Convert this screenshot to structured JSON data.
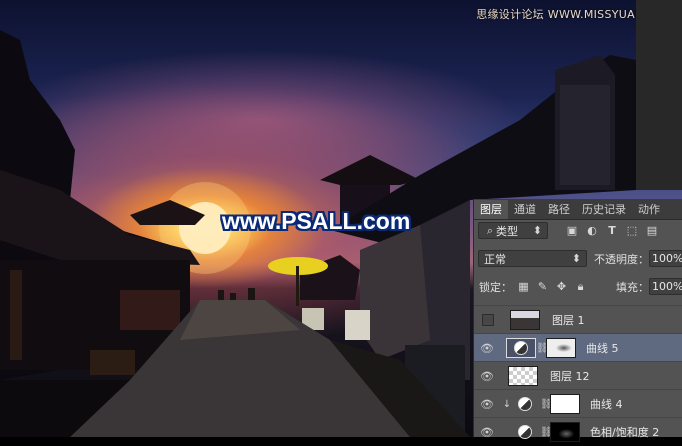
{
  "watermark": {
    "top_right": "思缘设计论坛 WWW.MISSYUAN.COM",
    "center": "www.PSALL.com"
  },
  "layers_panel": {
    "tabs": [
      {
        "label": "图层",
        "active": true
      },
      {
        "label": "通道",
        "active": false
      },
      {
        "label": "路径",
        "active": false
      },
      {
        "label": "历史记录",
        "active": false
      },
      {
        "label": "动作",
        "active": false
      }
    ],
    "filter_kind": "类型",
    "blend_mode": "正常",
    "opacity_label": "不透明度：",
    "opacity_value": "100%",
    "lock_label": "锁定：",
    "fill_label": "填充：",
    "fill_value": "100%",
    "layers": [
      {
        "name": "图层 1",
        "visible": false,
        "selected": false,
        "thumb": "photo"
      },
      {
        "name": "曲线 5",
        "visible": true,
        "selected": true,
        "thumb": "curves-mask"
      },
      {
        "name": "图层 12",
        "visible": true,
        "selected": false,
        "thumb": "transparent"
      },
      {
        "name": "曲线 4",
        "visible": true,
        "selected": false,
        "thumb": "white-mask",
        "clipped": true
      },
      {
        "name": "色相/饱和度 2",
        "visible": true,
        "selected": false,
        "thumb": "black-mask"
      }
    ]
  },
  "colors": {
    "panel_bg": "#535353",
    "tab_bar": "#3c3c3c",
    "selected_row": "#5f6a80",
    "watermark_outline": "#0a2a78"
  }
}
